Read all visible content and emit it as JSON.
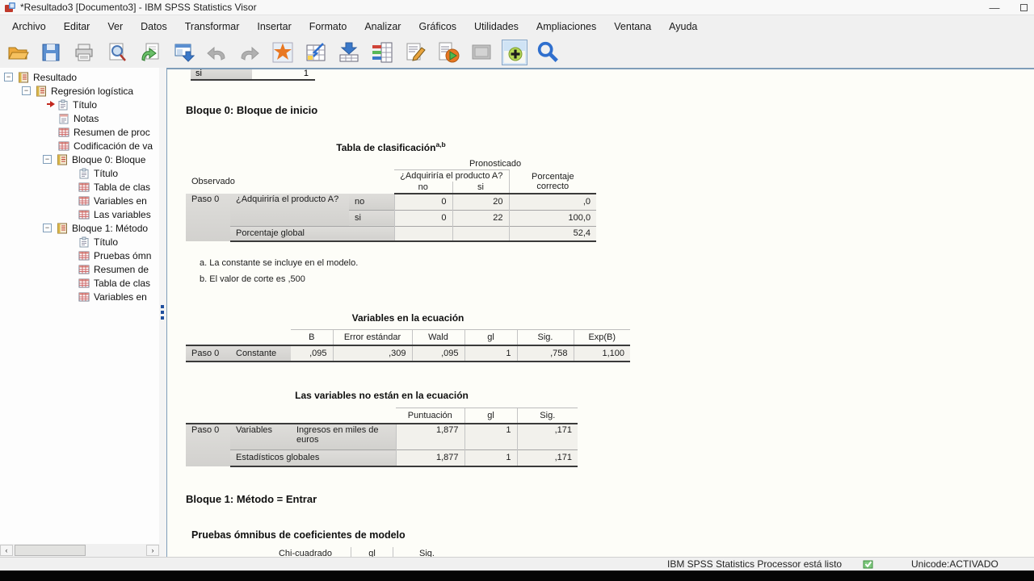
{
  "window": {
    "title": "*Resultado3 [Documento3] - IBM SPSS Statistics Visor"
  },
  "menu": {
    "items": [
      "Archivo",
      "Editar",
      "Ver",
      "Datos",
      "Transformar",
      "Insertar",
      "Formato",
      "Analizar",
      "Gráficos",
      "Utilidades",
      "Ampliaciones",
      "Ventana",
      "Ayuda"
    ]
  },
  "toolbar": {
    "icons": [
      "open",
      "save",
      "print",
      "print-preview",
      "recall-dialogs",
      "export",
      "undo",
      "redo",
      "goto-data",
      "goto-case",
      "goto-variable",
      "variables",
      "edit-output",
      "run-script",
      "select-last-output",
      "show-hide-output",
      "find"
    ]
  },
  "tree": {
    "items": [
      {
        "label": "Resultado"
      },
      {
        "label": "Regresión logística"
      },
      {
        "label": "Título"
      },
      {
        "label": "Notas"
      },
      {
        "label": "Resumen de proc"
      },
      {
        "label": "Codificación de va"
      },
      {
        "label": "Bloque 0: Bloque"
      },
      {
        "label": "Título"
      },
      {
        "label": "Tabla de clas"
      },
      {
        "label": "Variables en"
      },
      {
        "label": "Las variables"
      },
      {
        "label": "Bloque 1: Método"
      },
      {
        "label": "Título"
      },
      {
        "label": "Pruebas ómn"
      },
      {
        "label": "Resumen de"
      },
      {
        "label": "Tabla de clas"
      },
      {
        "label": "Variables en"
      }
    ]
  },
  "content": {
    "top_partial_row": {
      "label": "si",
      "value": "1"
    },
    "block0_heading": "Bloque 0: Bloque de inicio",
    "classification": {
      "title": "Tabla de clasificación",
      "title_sup": "a,b",
      "header": {
        "pronosticado": "Pronosticado",
        "observado": "Observado",
        "question": "¿Adquiriría el producto A?",
        "no": "no",
        "si": "si",
        "pct": "Porcentaje correcto"
      },
      "body": {
        "paso": "Paso 0",
        "question": "¿Adquiriría el producto A?",
        "row_no": {
          "label": "no",
          "values": [
            "0",
            "20",
            ",0"
          ]
        },
        "row_si": {
          "label": "si",
          "values": [
            "0",
            "22",
            "100,0"
          ]
        },
        "global": {
          "label": "Porcentaje global",
          "value": "52,4"
        }
      },
      "footnotes": [
        "a. La constante se incluye en el modelo.",
        "b. El valor de corte es ,500"
      ]
    },
    "variables_eq": {
      "title": "Variables en la ecuación",
      "headers": [
        "B",
        "Error estándar",
        "Wald",
        "gl",
        "Sig.",
        "Exp(B)"
      ],
      "row": {
        "paso": "Paso 0",
        "name": "Constante",
        "values": [
          ",095",
          ",309",
          ",095",
          "1",
          ",758",
          "1,100"
        ]
      }
    },
    "not_in_eq": {
      "title": "Las variables no están en la ecuación",
      "headers": [
        "Puntuación",
        "gl",
        "Sig."
      ],
      "row_variables": {
        "paso": "Paso 0",
        "group": "Variables",
        "name": "Ingresos en miles de euros",
        "values": [
          "1,877",
          "1",
          ",171"
        ]
      },
      "row_global": {
        "label": "Estadísticos globales",
        "values": [
          "1,877",
          "1",
          ",171"
        ]
      }
    },
    "block1_heading": "Bloque 1: Método = Entrar",
    "omnibus": {
      "title": "Pruebas ómnibus de coeficientes de modelo",
      "headers": [
        "Chi-cuadrado",
        "gl",
        "Sig."
      ]
    }
  },
  "statusbar": {
    "processor": "IBM SPSS Statistics Processor está listo",
    "unicode": "Unicode:ACTIVADO"
  },
  "colors": {
    "processor_ready_green": "#4caf50",
    "pane_border_blue": "#7f9db9",
    "goto_star_orange": "#e87722"
  }
}
